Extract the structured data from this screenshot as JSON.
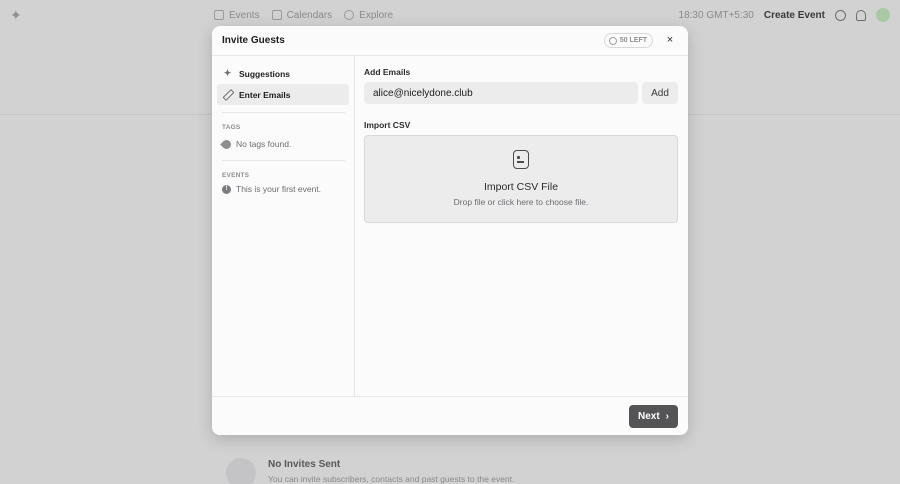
{
  "app": {
    "nav": [
      {
        "label": "Events",
        "icon": "calendar-check-icon"
      },
      {
        "label": "Calendars",
        "icon": "calendar-icon"
      },
      {
        "label": "Explore",
        "icon": "compass-icon"
      }
    ],
    "time": "18:30 GMT+5:30",
    "create_event": "Create Event",
    "bg_card": {
      "title": "No Invites Sent",
      "subtitle": "You can invite subscribers, contacts and past guests to the event."
    }
  },
  "modal": {
    "title": "Invite Guests",
    "remaining_badge": "50 LEFT",
    "close_symbol": "×",
    "sidebar": {
      "items": [
        {
          "label": "Suggestions",
          "icon": "sparkles-icon",
          "active": false
        },
        {
          "label": "Enter Emails",
          "icon": "pencil-icon",
          "active": true
        }
      ],
      "tags_label": "TAGS",
      "tags_empty": "No tags found.",
      "events_label": "EVENTS",
      "events_text": "This is your first event."
    },
    "main": {
      "add_emails_label": "Add Emails",
      "email_value": "alice@nicelydone.club",
      "add_button": "Add",
      "import_csv_label": "Import CSV",
      "dropzone_title": "Import CSV File",
      "dropzone_subtitle": "Drop file or click here to choose file."
    },
    "footer": {
      "next_button": "Next"
    }
  },
  "colors": {
    "overlay_bg": "#d2d2d3",
    "modal_bg": "#fbfbfb",
    "input_bg": "#ececed",
    "primary_button": "#545457"
  }
}
